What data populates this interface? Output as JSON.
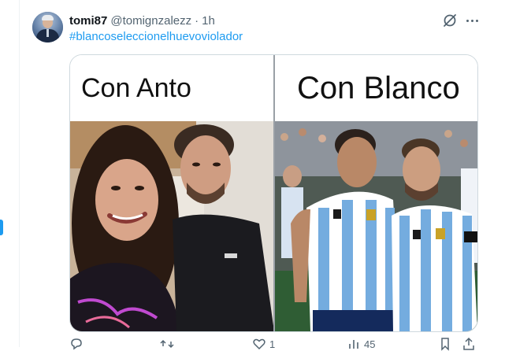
{
  "tweet": {
    "author_name": "tomi87",
    "author_handle": "@tomignzalezz",
    "separator": "·",
    "time": "1h",
    "hashtag": "#blancoseleccionelhuevoviolador"
  },
  "media": {
    "left_caption": "Con Anto",
    "right_caption": "Con Blanco"
  },
  "actions": {
    "replies": "",
    "retweets": "",
    "likes": "1",
    "views": "45"
  },
  "colors": {
    "accent": "#1d9bf0",
    "text_primary": "#0f1419",
    "text_secondary": "#536471",
    "border": "#cfd9de"
  },
  "icons": [
    "grok-icon",
    "more-icon",
    "reply-icon",
    "retweet-icon",
    "like-icon",
    "views-icon",
    "bookmark-icon",
    "share-icon"
  ]
}
